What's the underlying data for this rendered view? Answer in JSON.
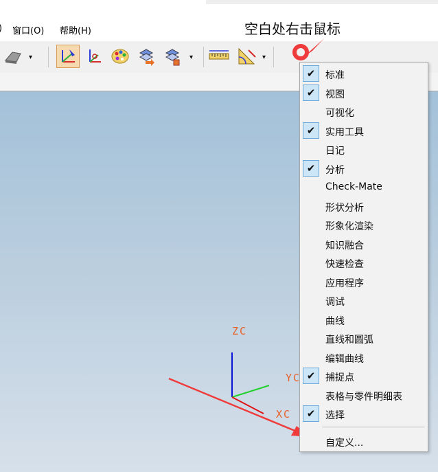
{
  "menubar": {
    "paren": ")",
    "window": "窗口(O)",
    "help": "帮助(H)"
  },
  "annotation": "空白处右击鼠标",
  "axes": {
    "x": "XC",
    "y": "YC",
    "z": "ZC"
  },
  "context_menu": {
    "items": [
      {
        "label": "标准",
        "checked": true
      },
      {
        "label": "视图",
        "checked": true
      },
      {
        "label": "可视化",
        "checked": false
      },
      {
        "label": "实用工具",
        "checked": true
      },
      {
        "label": "日记",
        "checked": false
      },
      {
        "label": "分析",
        "checked": true
      },
      {
        "label": "Check-Mate",
        "checked": false
      },
      {
        "label": "形状分析",
        "checked": false
      },
      {
        "label": "形象化渲染",
        "checked": false
      },
      {
        "label": "知识融合",
        "checked": false
      },
      {
        "label": "快速检查",
        "checked": false
      },
      {
        "label": "应用程序",
        "checked": false
      },
      {
        "label": "调试",
        "checked": false
      },
      {
        "label": "曲线",
        "checked": false
      },
      {
        "label": "直线和圆弧",
        "checked": false
      },
      {
        "label": "编辑曲线",
        "checked": false
      },
      {
        "label": "捕捉点",
        "checked": true
      },
      {
        "label": "表格与零件明细表",
        "checked": false
      },
      {
        "label": "选择",
        "checked": true
      }
    ],
    "customize": "自定义...",
    "check_glyph": "✔"
  },
  "toolbar": {
    "dropdown_glyph": "▾",
    "icons": [
      "shaded-view-icon",
      "wcs-dynamic-icon",
      "wcs-origin-icon",
      "color-palette-icon",
      "layer-move-icon",
      "layer-copy-icon",
      "measure-distance-icon",
      "measure-angle-icon"
    ]
  },
  "colors": {
    "annotation_red": "#ef3b3b",
    "axis_label": "#e8632a",
    "x_axis": "#e01515",
    "y_axis": "#1fd12a",
    "z_axis": "#0a14d6",
    "check_bg": "#cde6f7"
  }
}
